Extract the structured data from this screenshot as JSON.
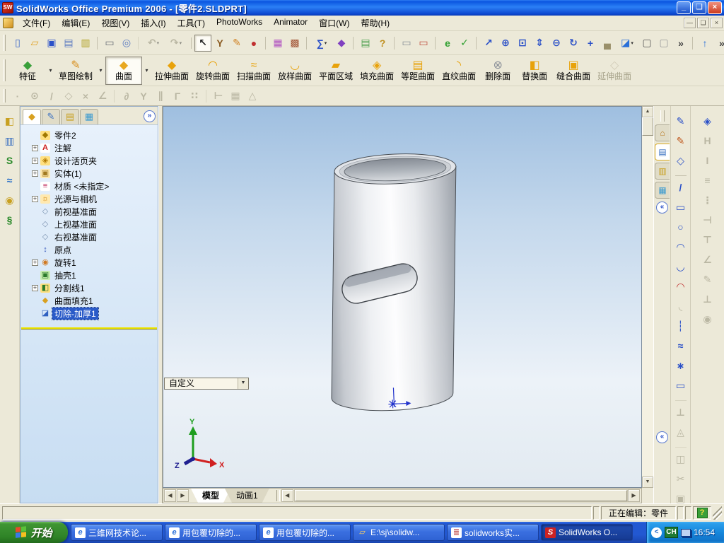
{
  "ui": {
    "expand_glyph": "+",
    "dropdown_glyph": "▾",
    "overflow_glyph": "»",
    "collapse_glyph": "«",
    "scroll_up": "▲",
    "scroll_down": "▼",
    "scroll_left": "◀",
    "scroll_right": "▶",
    "app_logo": "SW"
  },
  "window": {
    "title": "SolidWorks Office Premium 2006 - [零件2.SLDPRT]",
    "controls": {
      "minimize": "_",
      "restore": "❏",
      "close": "×"
    },
    "child_controls": {
      "minimize": "—",
      "restore": "❏",
      "close": "×"
    }
  },
  "menu": {
    "items": [
      {
        "name": "menu-file",
        "label": "文件(F)"
      },
      {
        "name": "menu-edit",
        "label": "编辑(E)"
      },
      {
        "name": "menu-view",
        "label": "视图(V)"
      },
      {
        "name": "menu-insert",
        "label": "插入(I)"
      },
      {
        "name": "menu-tools",
        "label": "工具(T)"
      },
      {
        "name": "menu-photoworks",
        "label": "PhotoWorks"
      },
      {
        "name": "menu-animator",
        "label": "Animator"
      },
      {
        "name": "menu-window",
        "label": "窗口(W)"
      },
      {
        "name": "menu-help",
        "label": "帮助(H)"
      }
    ]
  },
  "toolbars": {
    "standard": [
      {
        "name": "new-document-icon",
        "glyph": "▯",
        "color": "#3a66c8"
      },
      {
        "name": "open-folder-icon",
        "glyph": "▱",
        "color": "#e0a020"
      },
      {
        "name": "save-icon",
        "glyph": "▣",
        "color": "#2a50c8"
      },
      {
        "name": "make-drawing-from-part-icon",
        "glyph": "▤",
        "color": "#5a7ac0"
      },
      {
        "name": "make-assembly-from-part-icon",
        "glyph": "▥",
        "color": "#b0a020"
      },
      {
        "name": "print-icon",
        "glyph": "▭",
        "color": "#6a7078",
        "sep": true
      },
      {
        "name": "print-preview-icon",
        "glyph": "◎",
        "color": "#5a7ac0"
      },
      {
        "name": "undo-icon",
        "glyph": "↶",
        "color": "#8a8670",
        "disabled": true,
        "dropdown": true,
        "sep": true
      },
      {
        "name": "redo-icon",
        "glyph": "↷",
        "color": "#8a8670",
        "disabled": true,
        "dropdown": true
      },
      {
        "name": "select-icon",
        "glyph": "↖",
        "color": "#222222",
        "boxed": true,
        "sep": true
      },
      {
        "name": "selection-filter-icon",
        "glyph": "Y",
        "color": "#8a5a20"
      },
      {
        "name": "sketch-toggle-icon",
        "glyph": "✎",
        "color": "#d08020"
      },
      {
        "name": "rebuild-icon",
        "glyph": "●",
        "color": "#c03030"
      },
      {
        "name": "edit-color-icon",
        "glyph": "▦",
        "color": "#b050c0",
        "sep": true
      },
      {
        "name": "texture-icon",
        "glyph": "▩",
        "color": "#a05030"
      },
      {
        "name": "measure-icon",
        "glyph": "∑",
        "color": "#2a50c8",
        "dropdown": true,
        "sep": true
      },
      {
        "name": "photoworks-render-icon",
        "glyph": "◆",
        "color": "#8040c0"
      },
      {
        "name": "feature-statistics-icon",
        "glyph": "▤",
        "color": "#50a050",
        "sep": true
      },
      {
        "name": "help-icon",
        "glyph": "?",
        "color": "#c09020"
      },
      {
        "name": "solidworks-explorer-icon",
        "glyph": "▭",
        "color": "#8a9098",
        "sep": true
      },
      {
        "name": "edrawings-publish-icon",
        "glyph": "▭",
        "color": "#c05040"
      },
      {
        "name": "internet-e-icon",
        "glyph": "e",
        "color": "#30a030",
        "sep": true
      },
      {
        "name": "hyperlink-icon",
        "glyph": "✓",
        "color": "#30a030"
      },
      {
        "name": "zoom-to-selection-icon",
        "glyph": "↗",
        "color": "#2a50c8",
        "sep": true
      },
      {
        "name": "zoom-to-fit-icon",
        "glyph": "⊕",
        "color": "#2a50c8"
      },
      {
        "name": "zoom-to-area-icon",
        "glyph": "⊡",
        "color": "#2a50c8"
      },
      {
        "name": "zoom-in-out-icon",
        "glyph": "⇕",
        "color": "#2a50c8"
      },
      {
        "name": "zoom-out-icon",
        "glyph": "⊖",
        "color": "#2a50c8"
      },
      {
        "name": "rotate-view-icon",
        "glyph": "↻",
        "color": "#2a50c8"
      },
      {
        "name": "pan-icon",
        "glyph": "+",
        "color": "#2a50c8"
      },
      {
        "name": "shadow-icon",
        "glyph": "▄",
        "color": "#9a906a"
      },
      {
        "name": "section-view-icon",
        "glyph": "◪",
        "color": "#2a70d8",
        "dropdown": true
      },
      {
        "name": "wireframe-icon",
        "glyph": "▢",
        "color": "#555555"
      },
      {
        "name": "hidden-lines-visible-icon",
        "glyph": "▢",
        "color": "#999999"
      },
      {
        "name": "toolbar-overflow-icon",
        "glyph": "»",
        "color": "#444444"
      },
      {
        "name": "reference-plane-icon",
        "glyph": "↑",
        "color": "#2a70d8",
        "sep": true
      },
      {
        "name": "toolbar-overflow-2-icon",
        "glyph": "»",
        "color": "#444444"
      }
    ],
    "surface_groups": [
      {
        "name": "features-group-button",
        "label": "特征",
        "glyph": "◆",
        "color": "#3aa03a",
        "dropdown": true
      },
      {
        "name": "sketch-group-button",
        "label": "草图绘制",
        "glyph": "✎",
        "color": "#d89020",
        "dropdown": true
      },
      {
        "name": "surfaces-group-button",
        "label": "曲面",
        "glyph": "◆",
        "color": "#e8a820",
        "dropdown": true,
        "pressed": true
      }
    ],
    "surface_commands": [
      {
        "name": "extruded-surface-button",
        "label": "拉伸曲面",
        "glyph": "◆",
        "color": "#e8a20a"
      },
      {
        "name": "revolved-surface-button",
        "label": "旋转曲面",
        "glyph": "◠",
        "color": "#e8a20a"
      },
      {
        "name": "swept-surface-button",
        "label": "扫描曲面",
        "glyph": "≈",
        "color": "#e8a20a"
      },
      {
        "name": "lofted-surface-button",
        "label": "放样曲面",
        "glyph": "◡",
        "color": "#e8a20a"
      },
      {
        "name": "planar-surface-button",
        "label": "平面区域",
        "glyph": "▰",
        "color": "#e8a20a"
      },
      {
        "name": "filled-surface-button",
        "label": "填充曲面",
        "glyph": "◈",
        "color": "#e8a20a"
      },
      {
        "name": "offset-surface-button",
        "label": "等距曲面",
        "glyph": "▤",
        "color": "#e8a20a"
      },
      {
        "name": "ruled-surface-button",
        "label": "直纹曲面",
        "glyph": "◝",
        "color": "#e8a20a"
      },
      {
        "name": "delete-face-button",
        "label": "删除面",
        "glyph": "⊗",
        "color": "#8a8f98"
      },
      {
        "name": "replace-face-button",
        "label": "替换面",
        "glyph": "◧",
        "color": "#e8a20a"
      },
      {
        "name": "knit-surface-button",
        "label": "缝合曲面",
        "glyph": "▣",
        "color": "#e8a20a"
      },
      {
        "name": "extend-surface-button",
        "label": "延伸曲面",
        "glyph": "◇",
        "color": "#b8b098",
        "disabled": true
      }
    ],
    "relations": [
      {
        "name": "sketch-point-icon",
        "glyph": "·",
        "color": "#8a8670",
        "disabled": true
      },
      {
        "name": "circle-snap-icon",
        "glyph": "⊙",
        "color": "#8a8670",
        "disabled": true
      },
      {
        "name": "line-snap-icon",
        "glyph": "/",
        "color": "#8a8670",
        "disabled": true
      },
      {
        "name": "midpoint-snap-icon",
        "glyph": "◇",
        "color": "#8a8670",
        "disabled": true
      },
      {
        "name": "intersection-snap-icon",
        "glyph": "×",
        "color": "#8a8670",
        "disabled": true
      },
      {
        "name": "angle-snap-icon",
        "glyph": "∠",
        "color": "#8a8670",
        "disabled": true
      },
      {
        "name": "tangent-snap-icon",
        "glyph": "∂",
        "color": "#8a8670",
        "disabled": true,
        "sep": true
      },
      {
        "name": "perpendicular-snap-icon",
        "glyph": "Y",
        "color": "#8a8670",
        "disabled": true
      },
      {
        "name": "parallel-snap-icon",
        "glyph": "∥",
        "color": "#8a8670",
        "disabled": true
      },
      {
        "name": "corner-snap-icon",
        "glyph": "Γ",
        "color": "#8a8670",
        "disabled": true
      },
      {
        "name": "dotted-snap-icon",
        "glyph": "∷",
        "color": "#8a8670",
        "disabled": true
      },
      {
        "name": "length-snap-icon",
        "glyph": "⊢",
        "color": "#8a8670",
        "disabled": true,
        "sep": true
      },
      {
        "name": "grid-icon",
        "glyph": "▦",
        "color": "#8a8670",
        "disabled": true
      },
      {
        "name": "angle-grid-icon",
        "glyph": "△",
        "color": "#8a8670",
        "disabled": true
      }
    ],
    "curves": [
      {
        "name": "split-line-tool-icon",
        "glyph": "◧",
        "color": "#c8a020"
      },
      {
        "name": "projected-curve-icon",
        "glyph": "▥",
        "color": "#3a70c0"
      },
      {
        "name": "composite-curve-icon",
        "glyph": "S",
        "color": "#2a8a2a"
      },
      {
        "name": "spline-3d-icon",
        "glyph": "≈",
        "color": "#2a70c8"
      },
      {
        "name": "curve-through-points-icon",
        "glyph": "◉",
        "color": "#c8a020"
      },
      {
        "name": "helix-spiral-icon",
        "glyph": "§",
        "color": "#2a8a2a"
      }
    ],
    "sketch_right": [
      {
        "name": "sketch-icon",
        "glyph": "✎",
        "color": "#2a50c8"
      },
      {
        "name": "3d-sketch-icon",
        "glyph": "✎",
        "color": "#c05a20"
      },
      {
        "name": "edit-sketch-icon",
        "glyph": "◇",
        "color": "#2a50c8"
      },
      {
        "name": "line-tool-icon",
        "glyph": "/",
        "color": "#2a50c8",
        "sep": true
      },
      {
        "name": "rectangle-tool-icon",
        "glyph": "▭",
        "color": "#2a50c8"
      },
      {
        "name": "circle-tool-icon",
        "glyph": "○",
        "color": "#2a50c8"
      },
      {
        "name": "centerpoint-arc-icon",
        "glyph": "◠",
        "color": "#2a50c8"
      },
      {
        "name": "tangent-arc-icon",
        "glyph": "◡",
        "color": "#2a50c8"
      },
      {
        "name": "three-point-arc-icon",
        "glyph": "◠",
        "color": "#c03030"
      },
      {
        "name": "sketch-fillet-icon",
        "glyph": "◟",
        "color": "#8a8670",
        "disabled": true
      },
      {
        "name": "centerline-tool-icon",
        "glyph": "┆",
        "color": "#2a50c8"
      },
      {
        "name": "spline-tool-icon",
        "glyph": "≈",
        "color": "#2a50c8"
      },
      {
        "name": "point-tool-icon",
        "glyph": "∗",
        "color": "#2a50c8"
      },
      {
        "name": "sketch-text-icon",
        "glyph": "▭",
        "color": "#2a50c8"
      },
      {
        "name": "add-relation-icon",
        "glyph": "⊥",
        "color": "#8a8670",
        "disabled": true,
        "sep": true
      },
      {
        "name": "display-relations-icon",
        "glyph": "◬",
        "color": "#8a8670",
        "disabled": true
      },
      {
        "name": "mirror-entities-icon",
        "glyph": "◫",
        "color": "#8a8670",
        "disabled": true,
        "sep": true
      },
      {
        "name": "trim-entities-icon",
        "glyph": "✂",
        "color": "#8a8670",
        "disabled": true
      },
      {
        "name": "convert-entities-icon",
        "glyph": "▣",
        "color": "#8a8670",
        "disabled": true
      },
      {
        "name": "offset-entities-icon",
        "glyph": "≡",
        "color": "#8a8670",
        "disabled": true
      },
      {
        "name": "move-entities-icon",
        "glyph": "↔",
        "color": "#8a8670",
        "disabled": true
      }
    ],
    "dimensions_right": [
      {
        "name": "smart-dimension-icon",
        "glyph": "◈",
        "color": "#2a50c8"
      },
      {
        "name": "horizontal-dimension-icon",
        "glyph": "H",
        "color": "#8a8670",
        "disabled": true
      },
      {
        "name": "vertical-dimension-icon",
        "glyph": "I",
        "color": "#8a8670",
        "disabled": true
      },
      {
        "name": "baseline-dimension-icon",
        "glyph": "≡",
        "color": "#8a8670",
        "disabled": true
      },
      {
        "name": "ordinate-dimension-icon",
        "glyph": "⋮",
        "color": "#8a8670",
        "disabled": true
      },
      {
        "name": "horizontal-ordinate-icon",
        "glyph": "⊣",
        "color": "#8a8670",
        "disabled": true
      },
      {
        "name": "vertical-ordinate-icon",
        "glyph": "⊤",
        "color": "#8a8670",
        "disabled": true
      },
      {
        "name": "chamfer-dimension-icon",
        "glyph": "∠",
        "color": "#8a8670",
        "disabled": true
      },
      {
        "name": "autodimension-icon",
        "glyph": "✎",
        "color": "#8a8670",
        "disabled": true
      },
      {
        "name": "align-icon",
        "glyph": "⊥",
        "color": "#8a8670",
        "disabled": true
      },
      {
        "name": "attach-icon",
        "glyph": "◉",
        "color": "#8a8670",
        "disabled": true
      }
    ]
  },
  "featuremanager": {
    "tabs": [
      {
        "name": "featuremanager-tab",
        "glyph": "◆",
        "color": "#d8a020",
        "active": true
      },
      {
        "name": "propertymanager-tab",
        "glyph": "✎",
        "color": "#3a70c0"
      },
      {
        "name": "configurationmanager-tab",
        "glyph": "▤",
        "color": "#c8a020"
      },
      {
        "name": "displaymanager-tab",
        "glyph": "▦",
        "color": "#3a9ad0"
      }
    ],
    "tree": [
      {
        "name": "tree-item-part2",
        "icon": "part-icon",
        "glyph": "◆",
        "iconBg": "#ffe080",
        "iconFg": "#a07800",
        "label": "零件2"
      },
      {
        "name": "tree-item-annotations",
        "icon": "annotations-icon",
        "glyph": "A",
        "iconBg": "#ffffff",
        "iconFg": "#cc2020",
        "label": "注解",
        "plus": true
      },
      {
        "name": "tree-item-design-binder",
        "icon": "design-binder-icon",
        "glyph": "◈",
        "iconBg": "#ffe080",
        "iconFg": "#b07800",
        "label": "设计活页夹",
        "plus": true
      },
      {
        "name": "tree-item-solid-bodies",
        "icon": "solid-bodies-icon",
        "glyph": "▣",
        "iconBg": "#ffe9b0",
        "iconFg": "#a07820",
        "label": "实体(1)",
        "plus": true
      },
      {
        "name": "tree-item-material",
        "icon": "material-icon",
        "glyph": "≡",
        "iconBg": "#ffffff",
        "iconFg": "#c03060",
        "label": "材质 <未指定>"
      },
      {
        "name": "tree-item-lights-cameras",
        "icon": "lights-cameras-icon",
        "glyph": "☼",
        "iconBg": "#ffe9b0",
        "iconFg": "#d08000",
        "label": "光源与相机",
        "plus": true
      },
      {
        "name": "tree-item-front-plane",
        "icon": "plane-icon",
        "glyph": "◇",
        "iconBg": "transparent",
        "iconFg": "#7a92b0",
        "label": "前视基准面"
      },
      {
        "name": "tree-item-top-plane",
        "icon": "plane-icon",
        "glyph": "◇",
        "iconBg": "transparent",
        "iconFg": "#7a92b0",
        "label": "上视基准面"
      },
      {
        "name": "tree-item-right-plane",
        "icon": "plane-icon",
        "glyph": "◇",
        "iconBg": "transparent",
        "iconFg": "#7a92b0",
        "label": "右视基准面"
      },
      {
        "name": "tree-item-origin",
        "icon": "origin-icon",
        "glyph": "↕",
        "iconBg": "transparent",
        "iconFg": "#3355bb",
        "label": "原点"
      },
      {
        "name": "tree-item-revolve1",
        "icon": "revolve-icon",
        "glyph": "◉",
        "iconBg": "transparent",
        "iconFg": "#d07820",
        "label": "旋转1",
        "plus": true
      },
      {
        "name": "tree-item-shell1",
        "icon": "shell-icon",
        "glyph": "▣",
        "iconBg": "#c8eeb0",
        "iconFg": "#2a7a2a",
        "label": "抽壳1"
      },
      {
        "name": "tree-item-splitline1",
        "icon": "split-line-icon",
        "glyph": "◧",
        "iconBg": "#ffe080",
        "iconFg": "#2a7a2a",
        "label": "分割线1",
        "plus": true
      },
      {
        "name": "tree-item-surfacefill1",
        "icon": "surface-fill-icon",
        "glyph": "◆",
        "iconBg": "transparent",
        "iconFg": "#d8a020",
        "label": "曲面填充1"
      },
      {
        "name": "tree-item-cutthicken1",
        "icon": "cut-thicken-icon",
        "glyph": "◪",
        "iconBg": "transparent",
        "iconFg": "#3060c0",
        "label": "切除-加厚1",
        "selected": true
      }
    ]
  },
  "taskpane": {
    "tabs": [
      {
        "name": "taskpane-home-tab",
        "glyph": "⌂",
        "color": "#b87820"
      },
      {
        "name": "taskpane-design-library-tab",
        "glyph": "▤",
        "color": "#3a70c0",
        "active": true
      },
      {
        "name": "taskpane-file-explorer-tab",
        "glyph": "▥",
        "color": "#c8a020"
      },
      {
        "name": "taskpane-view-palette-tab",
        "glyph": "▦",
        "color": "#3a9ad0"
      }
    ]
  },
  "viewport": {
    "custom_dropdown": "自定义",
    "tabs": [
      {
        "name": "model-tab",
        "label": "模型",
        "active": true
      },
      {
        "name": "animation1-tab",
        "label": "动画1"
      }
    ],
    "triad": {
      "x": "X",
      "y": "Y",
      "z": "Z"
    }
  },
  "statusbar": {
    "editing": "正在编辑：零件",
    "help_glyph": "?"
  },
  "taskbar": {
    "start": "开始",
    "tasks": [
      {
        "name": "task-sanwei-forum",
        "label": "三维网技术论...",
        "glyph": "e",
        "iconBg": "#ffffff",
        "iconFg": "#2a6fd8"
      },
      {
        "name": "task-wrap-cut-1",
        "label": "用包覆切除的...",
        "glyph": "e",
        "iconBg": "#ffffff",
        "iconFg": "#2a6fd8"
      },
      {
        "name": "task-wrap-cut-2",
        "label": "用包覆切除的...",
        "glyph": "e",
        "iconBg": "#ffffff",
        "iconFg": "#2a6fd8"
      },
      {
        "name": "task-explorer-folder",
        "label": "E:\\sj\\solidw...",
        "glyph": "▱",
        "iconBg": "transparent",
        "iconFg": "#ffd060"
      },
      {
        "name": "task-winrar",
        "label": "solidworks实...",
        "glyph": "≣",
        "iconBg": "#ffffff",
        "iconFg": "#c05050"
      },
      {
        "name": "task-solidworks",
        "label": "SolidWorks O...",
        "glyph": "S",
        "iconBg": "#cc2222",
        "iconFg": "#ffffff",
        "active": true
      }
    ],
    "tray": {
      "chevron": "<",
      "ime": "CH",
      "time": "16:54"
    }
  }
}
